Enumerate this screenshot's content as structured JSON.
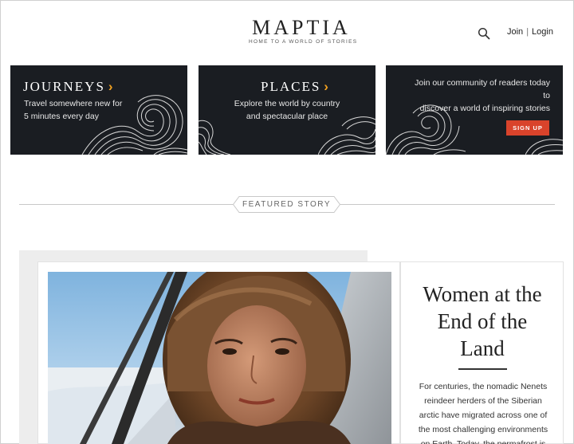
{
  "header": {
    "logo_title": "MAPTIA",
    "logo_tagline": "HOME TO A WORLD OF STORIES",
    "join_label": "Join",
    "separator": "|",
    "login_label": "Login"
  },
  "cards": {
    "journeys": {
      "title": "JOURNEYS",
      "chevron": "›",
      "desc_line1": "Travel somewhere new for",
      "desc_line2": "5 minutes every day"
    },
    "places": {
      "title": "PLACES",
      "chevron": "›",
      "desc_line1": "Explore the world by country",
      "desc_line2": "and spectacular place"
    },
    "community": {
      "desc_line1": "Join our community of readers today",
      "desc_line2": "to",
      "desc_line3": "discover a world of inspiring stories",
      "signup_label": "SIGN UP"
    }
  },
  "featured": {
    "badge_label": "FEATURED STORY",
    "story_title_line1": "Women at the",
    "story_title_line2": "End of the",
    "story_title_line3": "Land",
    "story_body_line1": "For centuries, the nomadic Nenets",
    "story_body_line2": "reindeer herders of the Siberian",
    "story_body_line3": "arctic have migrated across one of",
    "story_body_line4": "the most challenging environments",
    "story_body_line5": "on Earth. Today, the permafrost is"
  },
  "colors": {
    "card_bg": "#1a1d22",
    "accent_chevron": "#f0a020",
    "signup_button": "#d9432b"
  },
  "icons": {
    "search": "search-icon",
    "waves": "wave-pattern-icon"
  }
}
